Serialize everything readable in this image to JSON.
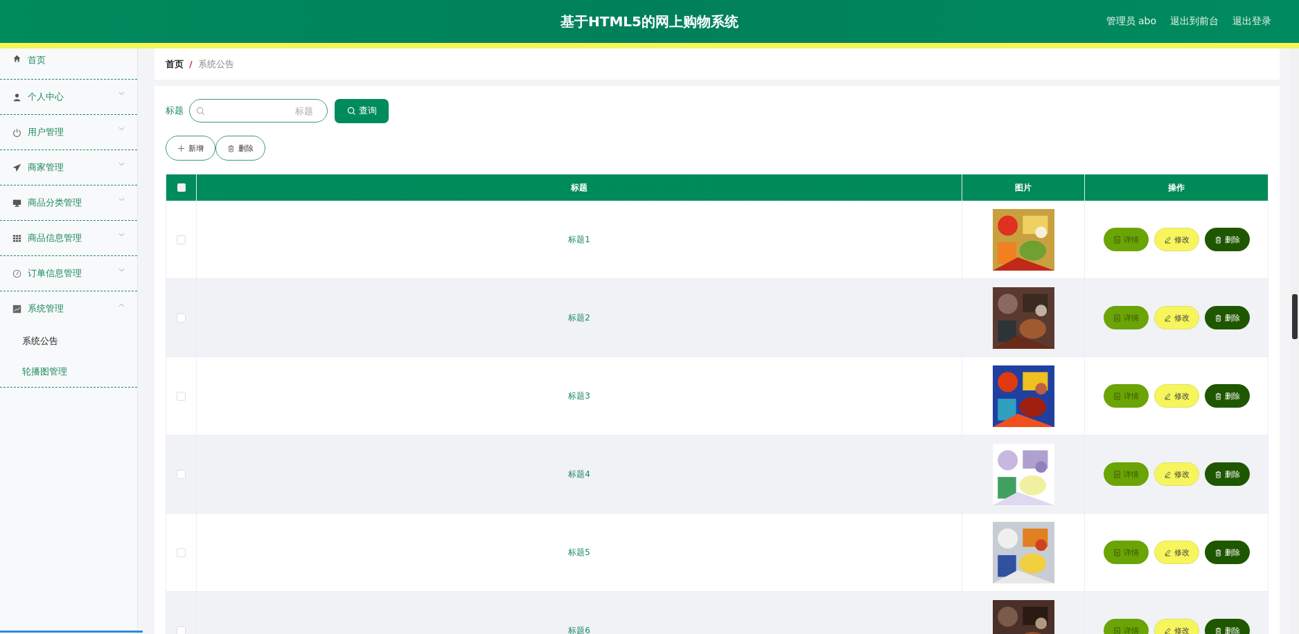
{
  "header": {
    "title": "基于HTML5的网上购物系统",
    "links": [
      "管理员 abo",
      "退出到前台",
      "退出登录"
    ]
  },
  "sidebar": {
    "items": [
      {
        "label": "首页",
        "kind": "link"
      },
      {
        "label": "个人中心",
        "kind": "submenu",
        "expanded": false
      },
      {
        "label": "用户管理",
        "kind": "submenu",
        "expanded": false
      },
      {
        "label": "商家管理",
        "kind": "submenu",
        "expanded": false
      },
      {
        "label": "商品分类管理",
        "kind": "submenu",
        "expanded": false
      },
      {
        "label": "商品信息管理",
        "kind": "submenu",
        "expanded": false
      },
      {
        "label": "订单信息管理",
        "kind": "submenu",
        "expanded": false
      },
      {
        "label": "系统管理",
        "kind": "submenu",
        "expanded": true,
        "children": [
          {
            "label": "系统公告",
            "selected": true
          },
          {
            "label": "轮播图管理",
            "selected": false
          }
        ]
      }
    ]
  },
  "breadcrumb": [
    "首页",
    "/",
    "系统公告"
  ],
  "search": {
    "label": "标题",
    "placeholder": "标题",
    "button": "查询"
  },
  "toolbar": [
    {
      "label": "新增",
      "kind": "add"
    },
    {
      "label": "删除",
      "kind": "delete"
    }
  ],
  "table": {
    "header_checked": false,
    "columns": [
      "标题",
      "图片",
      "操作"
    ],
    "rows": [
      {
        "checked": false,
        "title": "标题1",
        "actions": [
          {
            "label": "详情",
            "kind": "detail"
          },
          {
            "label": "修改",
            "kind": "edit"
          },
          {
            "label": "删除",
            "kind": "delete"
          }
        ]
      },
      {
        "checked": false,
        "title": "标题2",
        "actions": [
          {
            "label": "详情",
            "kind": "detail"
          },
          {
            "label": "修改",
            "kind": "edit"
          },
          {
            "label": "删除",
            "kind": "delete"
          }
        ]
      },
      {
        "checked": false,
        "title": "标题3",
        "actions": [
          {
            "label": "详情",
            "kind": "detail"
          },
          {
            "label": "修改",
            "kind": "edit"
          },
          {
            "label": "删除",
            "kind": "delete"
          }
        ]
      },
      {
        "checked": false,
        "title": "标题4",
        "actions": [
          {
            "label": "详情",
            "kind": "detail"
          },
          {
            "label": "修改",
            "kind": "edit"
          },
          {
            "label": "删除",
            "kind": "delete"
          }
        ]
      },
      {
        "checked": false,
        "title": "标题5",
        "actions": [
          {
            "label": "详情",
            "kind": "detail"
          },
          {
            "label": "修改",
            "kind": "edit"
          },
          {
            "label": "删除",
            "kind": "delete"
          }
        ]
      },
      {
        "checked": false,
        "title": "标题6",
        "actions": [
          {
            "label": "详情",
            "kind": "detail"
          },
          {
            "label": "修改",
            "kind": "edit"
          },
          {
            "label": "删除",
            "kind": "delete"
          }
        ]
      }
    ]
  }
}
